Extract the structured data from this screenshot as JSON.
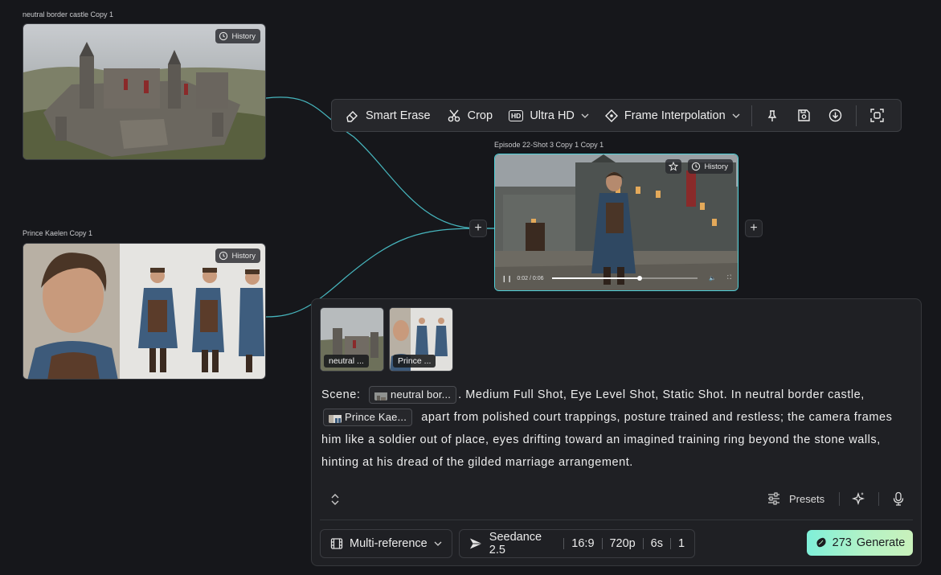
{
  "nodes": {
    "castle": {
      "title": "neutral border castle Copy 1",
      "history_label": "History"
    },
    "prince": {
      "title": "Prince Kaelen Copy 1",
      "history_label": "History"
    },
    "shot": {
      "title": "Episode 22-Shot 3 Copy 1 Copy 1",
      "history_label": "History",
      "time": "0:02 / 0:06",
      "progress": 0.6
    }
  },
  "toolbar": {
    "smart_erase": "Smart Erase",
    "crop": "Crop",
    "ultra_hd": "Ultra HD",
    "hd_badge": "HD",
    "frame_interp": "Frame Interpolation",
    "icons": [
      "pin-icon",
      "save-icon",
      "download-icon",
      "focus-icon"
    ]
  },
  "panel": {
    "refs": [
      {
        "label": "neutral ..."
      },
      {
        "label": "Prince ..."
      }
    ],
    "prompt": {
      "scene_label": "Scene:",
      "chip1": "neutral bor...",
      "text1": ". Medium Full Shot, Eye Level Shot, Static Shot. In neutral border castle,",
      "chip2": "Prince Kae...",
      "text2": "apart from polished court trappings, posture trained and restless; the camera frames him like a soldier out of place, eyes drifting toward an imagined training ring beyond the stone walls, hinting at his dread of the gilded marriage arrangement."
    },
    "presets_label": "Presets",
    "mode": "Multi-reference",
    "model": "Seedance 2.5",
    "ratio": "16:9",
    "resolution": "720p",
    "duration": "6s",
    "count": "1",
    "generate_credits": "273",
    "generate_label": "Generate"
  },
  "colors": {
    "connector": "#4fd1d9",
    "accent": "#7ff0d9",
    "background": "#16171b"
  }
}
